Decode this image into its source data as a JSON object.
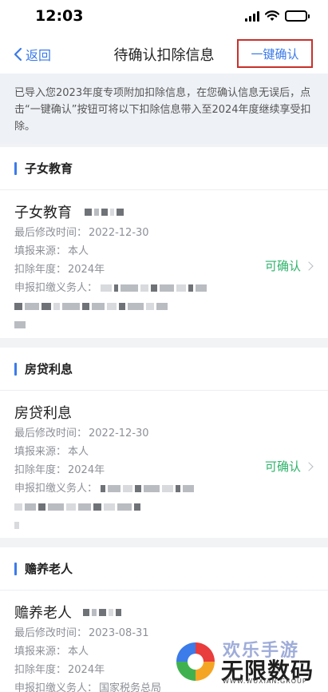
{
  "status_bar": {
    "time": "12:03"
  },
  "nav": {
    "back_label": "返回",
    "title": "待确认扣除信息",
    "confirm_all_label": "一键确认"
  },
  "notice": "已导入您2023年度专项附加扣除信息，在您确认信息无误后，点击“一键确认”按钮可将以下扣除信息带入至2024年度继续享受扣除。",
  "labels": {
    "modified": "最后修改时间：",
    "source": "填报来源：",
    "year": "扣除年度：",
    "withholder": "申报扣缴义务人："
  },
  "sections": [
    {
      "title": "子女教育",
      "item_name": "子女教育",
      "modified": "2022-12-30",
      "source": "本人",
      "year": "2024年",
      "withholder": "",
      "status": "可确认"
    },
    {
      "title": "房贷利息",
      "item_name": "房贷利息",
      "modified": "2022-12-30",
      "source": "本人",
      "year": "2024年",
      "withholder": "",
      "status": "可确认"
    },
    {
      "title": "赡养老人",
      "item_name": "赡养老人",
      "modified": "2023-08-31",
      "source": "本人",
      "year": "2024年",
      "withholder": "国家税务总局"
    }
  ],
  "watermark": {
    "top_text": "欢乐手游",
    "main_text": "无限数码",
    "url_text": "WWW.WUXIAN.GROUP"
  },
  "colors": {
    "accent": "#3b7bea",
    "confirmable_green": "#2eb36b",
    "highlight_border": "#c9302c",
    "background": "#f2f3f5"
  }
}
